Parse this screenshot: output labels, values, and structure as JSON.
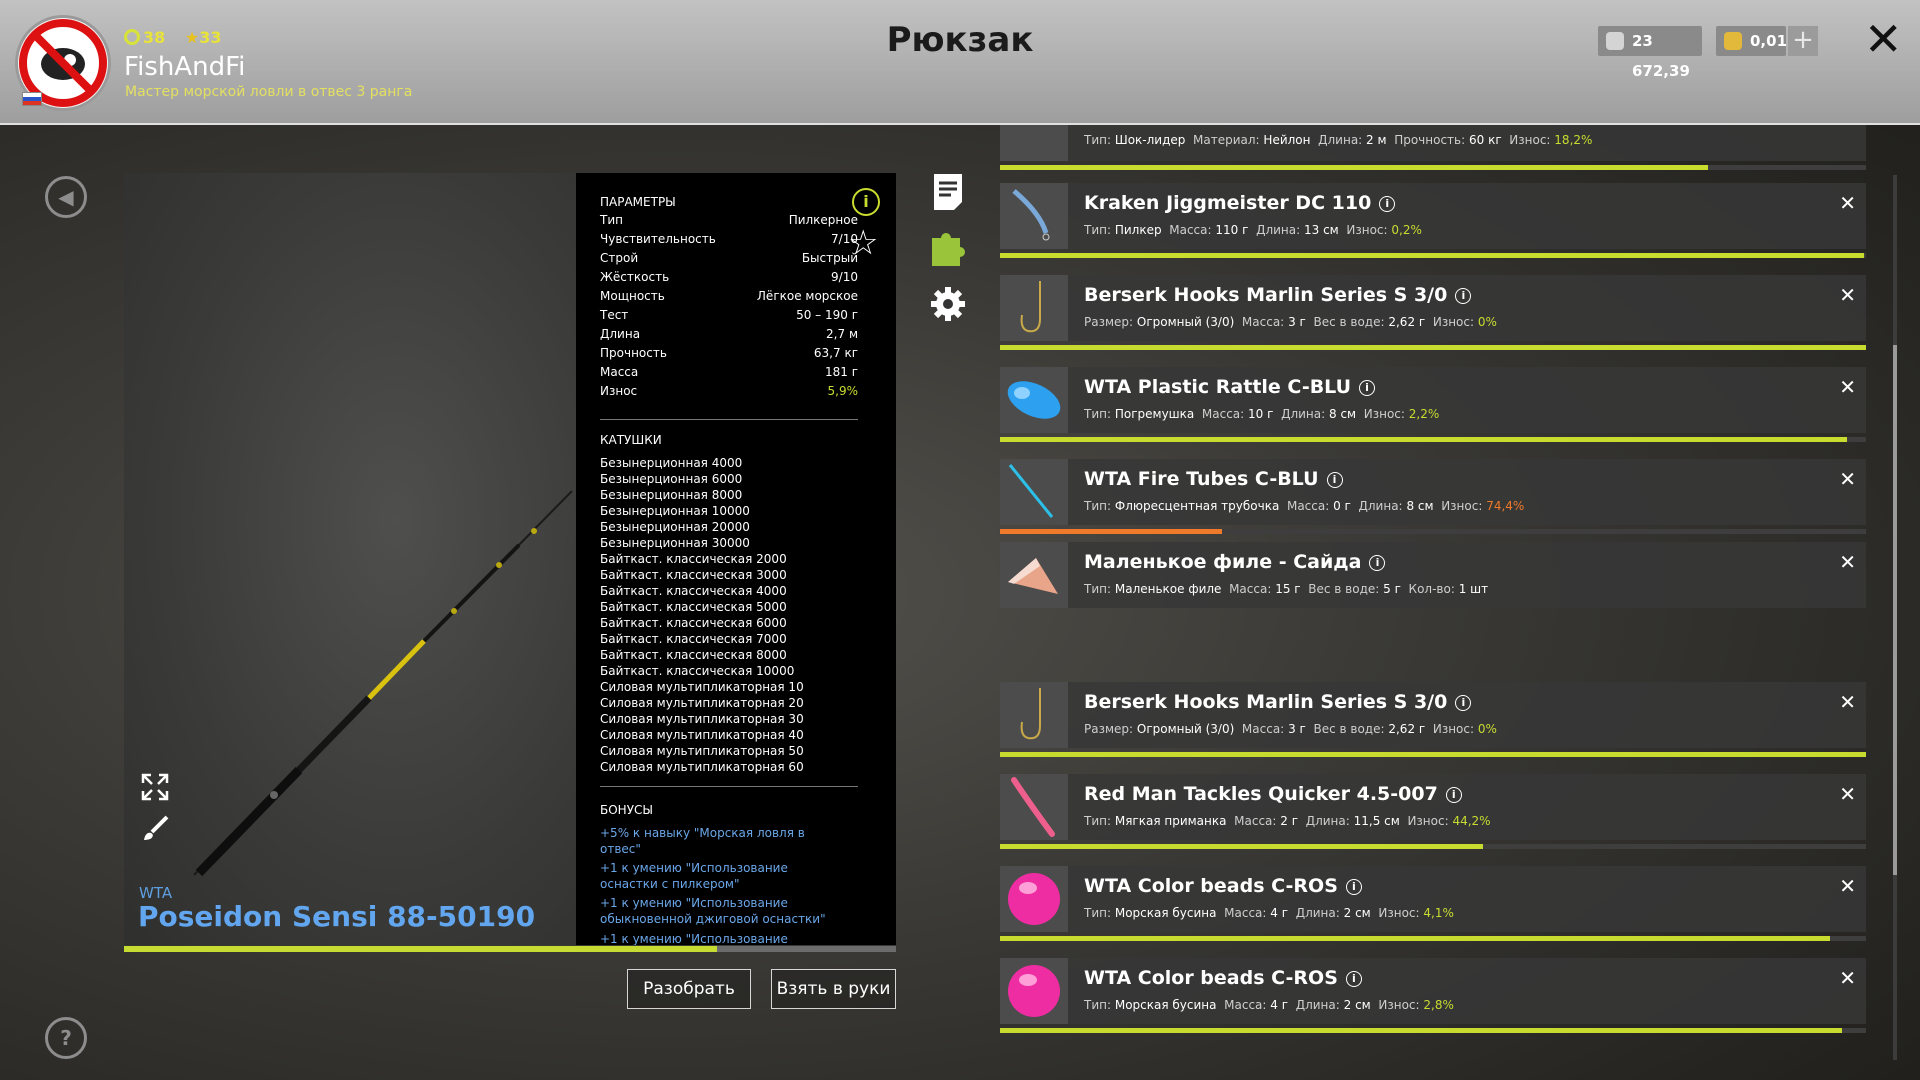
{
  "header": {
    "title": "Рюкзак",
    "user": {
      "level": "38",
      "stars": "33",
      "name": "FishAndFi",
      "rank_title": "Мастер морской ловли в отвес 3 ранга"
    },
    "currency": {
      "silver": "23 672,39",
      "gold": "0,01"
    },
    "plus_label": "+",
    "close_label": "✕"
  },
  "item": {
    "brand": "WTA",
    "name": "Poseidon Sensi 88-50190",
    "wear_fraction": 0.768,
    "params_title": "ПАРАМЕТРЫ",
    "params": [
      {
        "k": "Тип",
        "v": "Пилкерное"
      },
      {
        "k": "Чувствительность",
        "v": "7/10"
      },
      {
        "k": "Строй",
        "v": "Быстрый"
      },
      {
        "k": "Жёсткость",
        "v": "9/10"
      },
      {
        "k": "Мощность",
        "v": "Лёгкое морское"
      },
      {
        "k": "Тест",
        "v": "50 – 190 г"
      },
      {
        "k": "Длина",
        "v": "2,7 м"
      },
      {
        "k": "Прочность",
        "v": "63,7 кг"
      },
      {
        "k": "Масса",
        "v": "181 г"
      },
      {
        "k": "Износ",
        "v": "5,9%"
      }
    ],
    "reels_title": "КАТУШКИ",
    "reels": [
      "Безынерционная 4000",
      "Безынерционная 6000",
      "Безынерционная 8000",
      "Безынерционная 10000",
      "Безынерционная 20000",
      "Безынерционная 30000",
      "Байткаст. классическая 2000",
      "Байткаст. классическая 3000",
      "Байткаст. классическая 4000",
      "Байткаст. классическая 5000",
      "Байткаст. классическая 6000",
      "Байткаст. классическая 7000",
      "Байткаст. классическая 8000",
      "Байткаст. классическая 10000",
      "Силовая мультипликаторная 10",
      "Силовая мультипликаторная 20",
      "Силовая мультипликаторная 30",
      "Силовая мультипликаторная 40",
      "Силовая мультипликаторная 50",
      "Силовая мультипликаторная 60"
    ],
    "bonus_title": "БОНУСЫ",
    "bonuses": [
      "+5% к навыку \"Морская ловля в отвес\"",
      "+1 к умению \"Использование оснастки с пилкером\"",
      "+1 к умению \"Использование обыкновенной джиговой оснастки\"",
      "+1 к умению \"Использование"
    ]
  },
  "buttons": {
    "disassemble": "Разобрать",
    "take": "Взять в руки"
  },
  "icons": {
    "info": "i",
    "help": "?",
    "back": "◀"
  },
  "tackle": [
    {
      "name": "",
      "desc": [
        [
          "Тип:",
          "Шок-лидер"
        ],
        [
          "Материал:",
          "Нейлон"
        ],
        [
          "Длина:",
          "2 м"
        ],
        [
          "Прочность:",
          "60 кг"
        ]
      ],
      "wear_label": "Износ:",
      "wear": "18,2%",
      "wear_fraction": 0.818,
      "orange": false,
      "thumb": "leader"
    },
    {
      "name": "Kraken Jiggmeister DC 110",
      "desc": [
        [
          "Тип:",
          "Пилкер"
        ],
        [
          "Масса:",
          "110 г"
        ],
        [
          "Длина:",
          "13 см"
        ]
      ],
      "wear_label": "Износ:",
      "wear": "0,2%",
      "wear_fraction": 0.998,
      "orange": false,
      "thumb": "pilker"
    },
    {
      "name": "Berserk Hooks Marlin Series S 3/0",
      "desc": [
        [
          "Размер:",
          "Огромный (3/0)"
        ],
        [
          "Масса:",
          "3 г"
        ],
        [
          "Вес в воде:",
          "2,62 г"
        ]
      ],
      "wear_label": "Износ:",
      "wear": "0%",
      "wear_fraction": 1.0,
      "orange": false,
      "thumb": "hook"
    },
    {
      "name": "WTA Plastic Rattle C-BLU",
      "desc": [
        [
          "Тип:",
          "Погремушка"
        ],
        [
          "Масса:",
          "10 г"
        ],
        [
          "Длина:",
          "8 см"
        ]
      ],
      "wear_label": "Износ:",
      "wear": "2,2%",
      "wear_fraction": 0.978,
      "orange": false,
      "thumb": "rattle"
    },
    {
      "name": "WTA Fire Tubes C-BLU",
      "desc": [
        [
          "Тип:",
          "Флюресцентная трубочка"
        ],
        [
          "Масса:",
          "0 г"
        ],
        [
          "Длина:",
          "8 см"
        ]
      ],
      "wear_label": "Износ:",
      "wear": "74,4%",
      "wear_fraction": 0.256,
      "orange": true,
      "thumb": "tube"
    },
    {
      "name": "Маленькое филе - Сайда",
      "desc": [
        [
          "Тип:",
          "Маленькое филе"
        ],
        [
          "Масса:",
          "15 г"
        ],
        [
          "Вес в воде:",
          "5 г"
        ],
        [
          "Кол-во:",
          "1 шт"
        ]
      ],
      "wear_label": "",
      "wear": "",
      "wear_fraction": null,
      "orange": false,
      "thumb": "fillet"
    },
    {
      "name": "Berserk Hooks Marlin Series S 3/0",
      "desc": [
        [
          "Размер:",
          "Огромный (3/0)"
        ],
        [
          "Масса:",
          "3 г"
        ],
        [
          "Вес в воде:",
          "2,62 г"
        ]
      ],
      "wear_label": "Износ:",
      "wear": "0%",
      "wear_fraction": 1.0,
      "orange": false,
      "thumb": "hook"
    },
    {
      "name": "Red Man Tackles Quicker 4.5-007",
      "desc": [
        [
          "Тип:",
          "Мягкая приманка"
        ],
        [
          "Масса:",
          "2 г"
        ],
        [
          "Длина:",
          "11,5 см"
        ]
      ],
      "wear_label": "Износ:",
      "wear": "44,2%",
      "wear_fraction": 0.558,
      "orange": false,
      "thumb": "soft"
    },
    {
      "name": "WTA Color beads C-ROS",
      "desc": [
        [
          "Тип:",
          "Морская бусина"
        ],
        [
          "Масса:",
          "4 г"
        ],
        [
          "Длина:",
          "2 см"
        ]
      ],
      "wear_label": "Износ:",
      "wear": "4,1%",
      "wear_fraction": 0.959,
      "orange": false,
      "thumb": "bead"
    },
    {
      "name": "WTA Color beads C-ROS",
      "desc": [
        [
          "Тип:",
          "Морская бусина"
        ],
        [
          "Масса:",
          "4 г"
        ],
        [
          "Длина:",
          "2 см"
        ]
      ],
      "wear_label": "Износ:",
      "wear": "2,8%",
      "wear_fraction": 0.972,
      "orange": false,
      "thumb": "bead"
    }
  ],
  "colors": {
    "accent": "#c8dc30",
    "link": "#62a6ef",
    "warn": "#ef7a2a"
  }
}
